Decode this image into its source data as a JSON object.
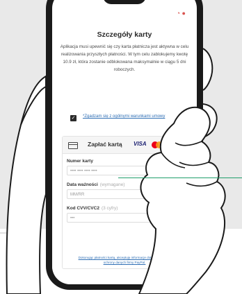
{
  "screen": {
    "title": "Szczegóły karty",
    "info_text": "Aplikacja musi upewnić się czy karta płatnicza jest aktywna w celu realizowania przyszłych płatności. W tym celu zablokujemy kwotę 10.9 zł, która zostanie odblokowana maksymalnie w ciągu 5 dni roboczych.",
    "consent": {
      "checked": true,
      "text": "*Zgadzam się z ogólnymi warunkami umowy"
    },
    "card_form": {
      "pay_label": "Zapłać kartą",
      "brand_visa": "VISA",
      "card_number_label": "Numer karty",
      "card_number_placeholder": "•••• •••• •••• ••••",
      "expiry_label": "Data ważności",
      "expiry_optional": "(wymagane)",
      "expiry_placeholder": "MM/RR",
      "cvc_label": "Kod CVV/CVC2",
      "cvc_optional": "(3 cyfry)",
      "cvc_placeholder": "•••",
      "legal_text": "Dokonując płatności kartą, akceptuję informacje dotyczące zasad ochrony danych firmy PayPal."
    }
  },
  "colors": {
    "link": "#2f6fb5",
    "phone_frame": "#1a1a1a",
    "pointer_line": "#1e9e6a",
    "mastercard_red": "#eb001b",
    "mastercard_yellow": "#f79e1b"
  }
}
